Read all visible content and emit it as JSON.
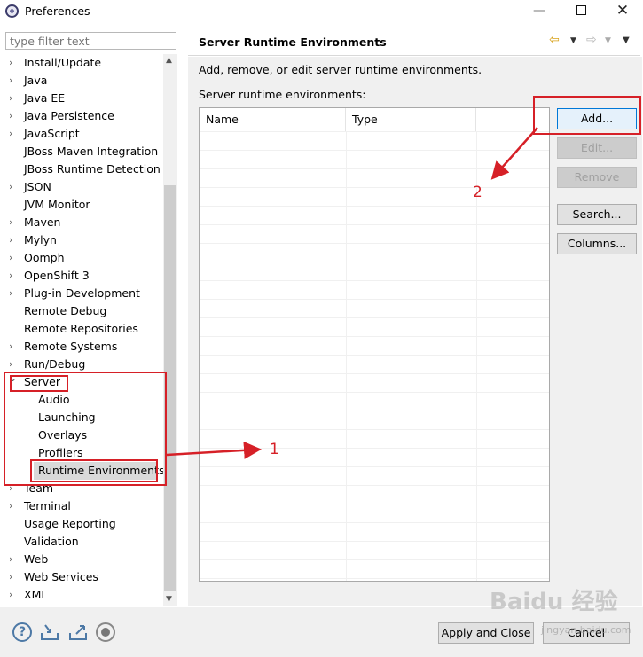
{
  "window": {
    "title": "Preferences",
    "minimize": "—",
    "close": "✕"
  },
  "sidebar": {
    "filter_placeholder": "type filter text",
    "items": [
      {
        "label": "Install/Update",
        "expandable": true
      },
      {
        "label": "Java",
        "expandable": true
      },
      {
        "label": "Java EE",
        "expandable": true
      },
      {
        "label": "Java Persistence",
        "expandable": true
      },
      {
        "label": "JavaScript",
        "expandable": true
      },
      {
        "label": "JBoss Maven Integration",
        "expandable": false
      },
      {
        "label": "JBoss Runtime Detection",
        "expandable": false
      },
      {
        "label": "JSON",
        "expandable": true
      },
      {
        "label": "JVM Monitor",
        "expandable": false
      },
      {
        "label": "Maven",
        "expandable": true
      },
      {
        "label": "Mylyn",
        "expandable": true
      },
      {
        "label": "Oomph",
        "expandable": true
      },
      {
        "label": "OpenShift 3",
        "expandable": true
      },
      {
        "label": "Plug-in Development",
        "expandable": true
      },
      {
        "label": "Remote Debug",
        "expandable": false
      },
      {
        "label": "Remote Repositories",
        "expandable": false
      },
      {
        "label": "Remote Systems",
        "expandable": true
      },
      {
        "label": "Run/Debug",
        "expandable": true
      },
      {
        "label": "Server",
        "expandable": true,
        "expanded": true
      },
      {
        "label": "Audio",
        "child": true
      },
      {
        "label": "Launching",
        "child": true
      },
      {
        "label": "Overlays",
        "child": true
      },
      {
        "label": "Profilers",
        "child": true
      },
      {
        "label": "Runtime Environments",
        "child": true,
        "selected": true
      },
      {
        "label": "Team",
        "expandable": true
      },
      {
        "label": "Terminal",
        "expandable": true
      },
      {
        "label": "Usage Reporting",
        "expandable": false
      },
      {
        "label": "Validation",
        "expandable": false
      },
      {
        "label": "Web",
        "expandable": true
      },
      {
        "label": "Web Services",
        "expandable": true
      },
      {
        "label": "XML",
        "expandable": true
      }
    ]
  },
  "page": {
    "title": "Server Runtime Environments",
    "description": "Add, remove, or edit server runtime environments.",
    "list_label": "Server runtime environments:",
    "columns": [
      "Name",
      "Type"
    ]
  },
  "buttons": {
    "add": "Add...",
    "edit": "Edit...",
    "remove": "Remove",
    "search": "Search...",
    "columns": "Columns..."
  },
  "footer": {
    "apply_close": "Apply and Close",
    "cancel": "Cancel"
  },
  "annotations": {
    "step1": "1",
    "step2": "2",
    "color": "#d62027"
  },
  "watermark": {
    "text": "Baidu 经验",
    "sub": "jingyan.baidu.com"
  }
}
